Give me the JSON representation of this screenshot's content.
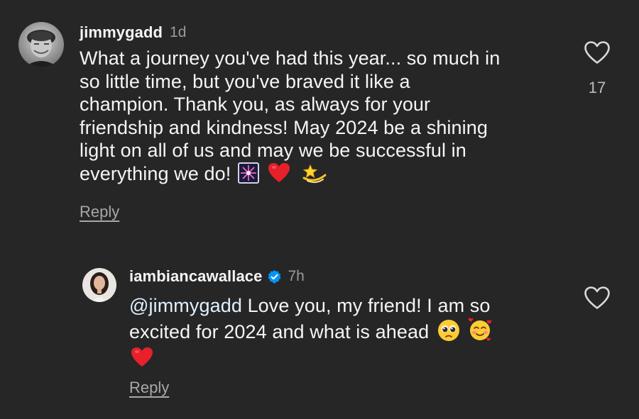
{
  "comments": [
    {
      "username": "jimmygadd",
      "time": "1d",
      "text": "What a journey you've had this year... so much in so little time, but you've braved it like a champion. Thank you, as always for your friendship and kindness! May 2024 be a shining light on all of us and may we be successful in everything we do!",
      "lines": [
        "What a journey you've had this year... so much in",
        "so little time, but you've braved it like a",
        "champion. Thank you, as always for your",
        "friendship and kindness! May 2024 be a shining",
        "light on all of us and may we be successful in",
        "everything we do!"
      ],
      "emojis": [
        "fireworks-emoji",
        "red-heart-emoji",
        "dizzy-star-emoji"
      ],
      "reply_label": "Reply",
      "like_count": "17"
    },
    {
      "username": "iambiancawallace",
      "verified": true,
      "time": "7h",
      "mention": "@jimmygadd",
      "lines": [
        "Love you, my friend! I am so",
        "excited for 2024 and what is ahead"
      ],
      "emojis": [
        "pleading-face-emoji",
        "smiling-face-with-hearts-emoji",
        "red-heart-emoji"
      ],
      "reply_label": "Reply"
    }
  ],
  "colors": {
    "background": "#262626",
    "text": "#f5f5f5",
    "muted": "#a8a8a8",
    "verified": "#0095f6",
    "heart_red": "#e8202a"
  },
  "icons": [
    "heart-outline-icon",
    "verified-badge-icon"
  ]
}
